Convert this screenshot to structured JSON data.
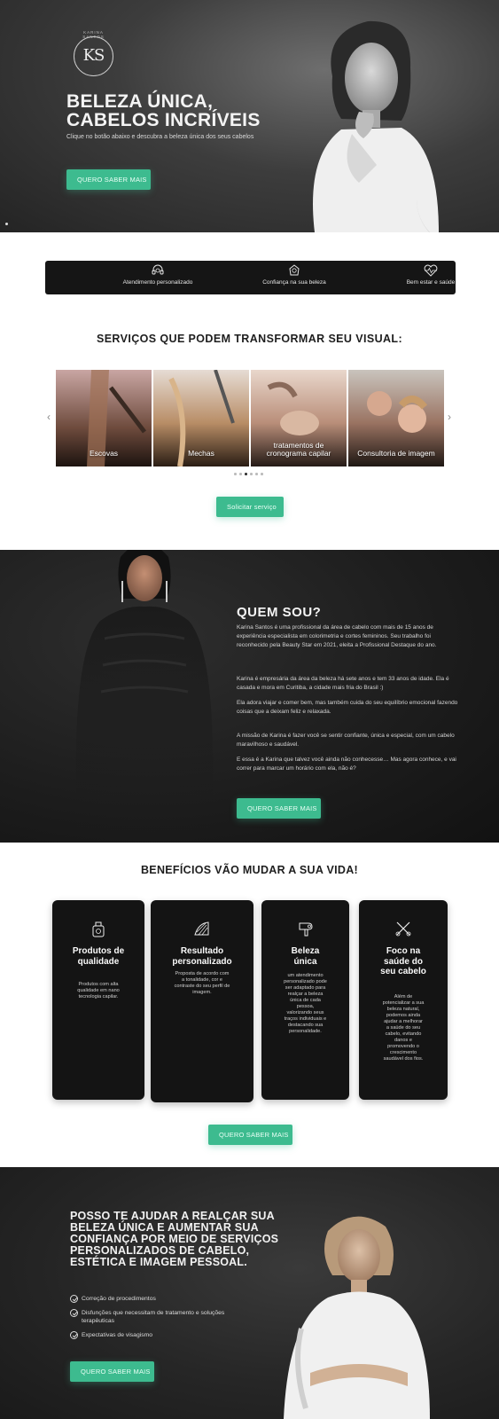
{
  "hero": {
    "logo_monogram": "KS",
    "logo_name": "KARINA SANTOS",
    "title_line1": "BELEZA ÚNICA,",
    "title_line2": "CABELOS INCRÍVEIS",
    "subtitle": "Clique no botão abaixo e descubra a beleza única dos seus cabelos",
    "cta": "QUERO SABER MAIS"
  },
  "features": [
    {
      "icon": "headset-icon",
      "label": "Atendimento personalizado"
    },
    {
      "icon": "beauty-face-icon",
      "label": "Confiança na sua beleza"
    },
    {
      "icon": "heart-pulse-icon",
      "label": "Bem estar e saúde"
    }
  ],
  "services": {
    "title": "SERVIÇOS QUE PODEM TRANSFORMAR SEU VISUAL:",
    "cards": [
      {
        "label_line1": "Escovas",
        "label_line2": ""
      },
      {
        "label_line1": "Mechas",
        "label_line2": ""
      },
      {
        "label_line1": "tratamentos de",
        "label_line2": "cronograma capilar"
      },
      {
        "label_line1": "Consultoria de imagem",
        "label_line2": ""
      }
    ],
    "cta": "Solicitar serviço",
    "prev_arrow": "‹",
    "next_arrow": "›"
  },
  "about": {
    "title": "QUEM SOU?",
    "paragraphs": [
      "Karina Santos é uma profissional da área de cabelo com mais de 15 anos de experiência especialista em colorimetria e cortes femininos. Seu trabalho foi reconhecido pela Beauty Star em 2021, eleita a Profissional Destaque do ano.",
      "Karina é empresária da área da beleza há sete anos e tem 33 anos de idade. Ela é casada e mora em Curitiba, a cidade mais fria do Brasil :)",
      "Ela adora viajar e comer bem, mas também cuida do seu equilíbrio emocional fazendo coisas que a deixam feliz e relaxada.",
      "A missão de Karina é fazer você se sentir confiante, única e especial, com um cabelo maravilhoso e saudável.",
      "E essa é a Karina que talvez você ainda não conhecesse… Mas agora conhece, e vai correr para marcar um horário com ela, não é?"
    ],
    "cta": "QUERO SABER MAIS"
  },
  "benefits": {
    "title": "BENEFÍCIOS VÃO MUDAR A SUA VIDA!",
    "cards": [
      {
        "icon": "product-bottle-icon",
        "title": "Produtos de qualidade",
        "text": "Produtos com alta qualidade em nano tecnologia capilar."
      },
      {
        "icon": "color-palette-icon",
        "title": "Resultado personalizado",
        "text": "Proposta de acordo com a tonalidade, cor e contraste do seu perfil de imagem."
      },
      {
        "icon": "hair-dryer-icon",
        "title": "Beleza única",
        "text": "um atendimento personalizado pode ser adaptado para realçar a beleza única de cada pessoa, valorizando seus traços individuais e destacando sua personalidade."
      },
      {
        "icon": "scissors-comb-icon",
        "title": "Foco na saúde do seu cabelo",
        "text": "Além de potencializar a sua beleza natural, podemos ainda ajudar a melhorar a saúde do seu cabelo, evitando danos e promovendo o crescimento saudável dos fios."
      }
    ],
    "cta": "QUERO SABER MAIS"
  },
  "help": {
    "title": "POSSO TE AJUDAR A REALÇAR SUA BELEZA ÚNICA E AUMENTAR SUA CONFIANÇA POR MEIO DE SERVIÇOS PERSONALIZADOS DE CABELO, ESTÉTICA E IMAGEM PESSOAL.",
    "items": [
      "Correção de procedimentos",
      "Disfunções que necessitam de tratamento e soluções terapêuticas",
      "Expectativas de visagismo"
    ],
    "cta": "QUERO SABER MAIS"
  },
  "colors": {
    "accent_green": "#3dbb8f",
    "dark_bg": "#151515"
  }
}
